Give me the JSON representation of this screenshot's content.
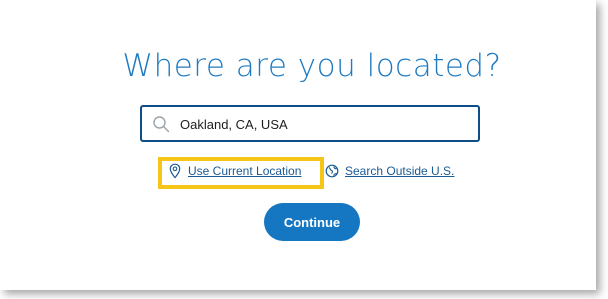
{
  "heading": "Where are you located?",
  "search": {
    "value": "Oakland, CA, USA",
    "icon": "search-icon"
  },
  "links": {
    "use_current_location": "Use Current Location",
    "use_current_location_icon": "location-pin-icon",
    "search_outside": "Search Outside U.S.",
    "search_outside_icon": "globe-icon"
  },
  "continue_label": "Continue",
  "colors": {
    "heading": "#1f7bc1",
    "input_border": "#0d4e86",
    "link": "#1a5a93",
    "button": "#1577c1",
    "highlight": "#f5c518"
  }
}
